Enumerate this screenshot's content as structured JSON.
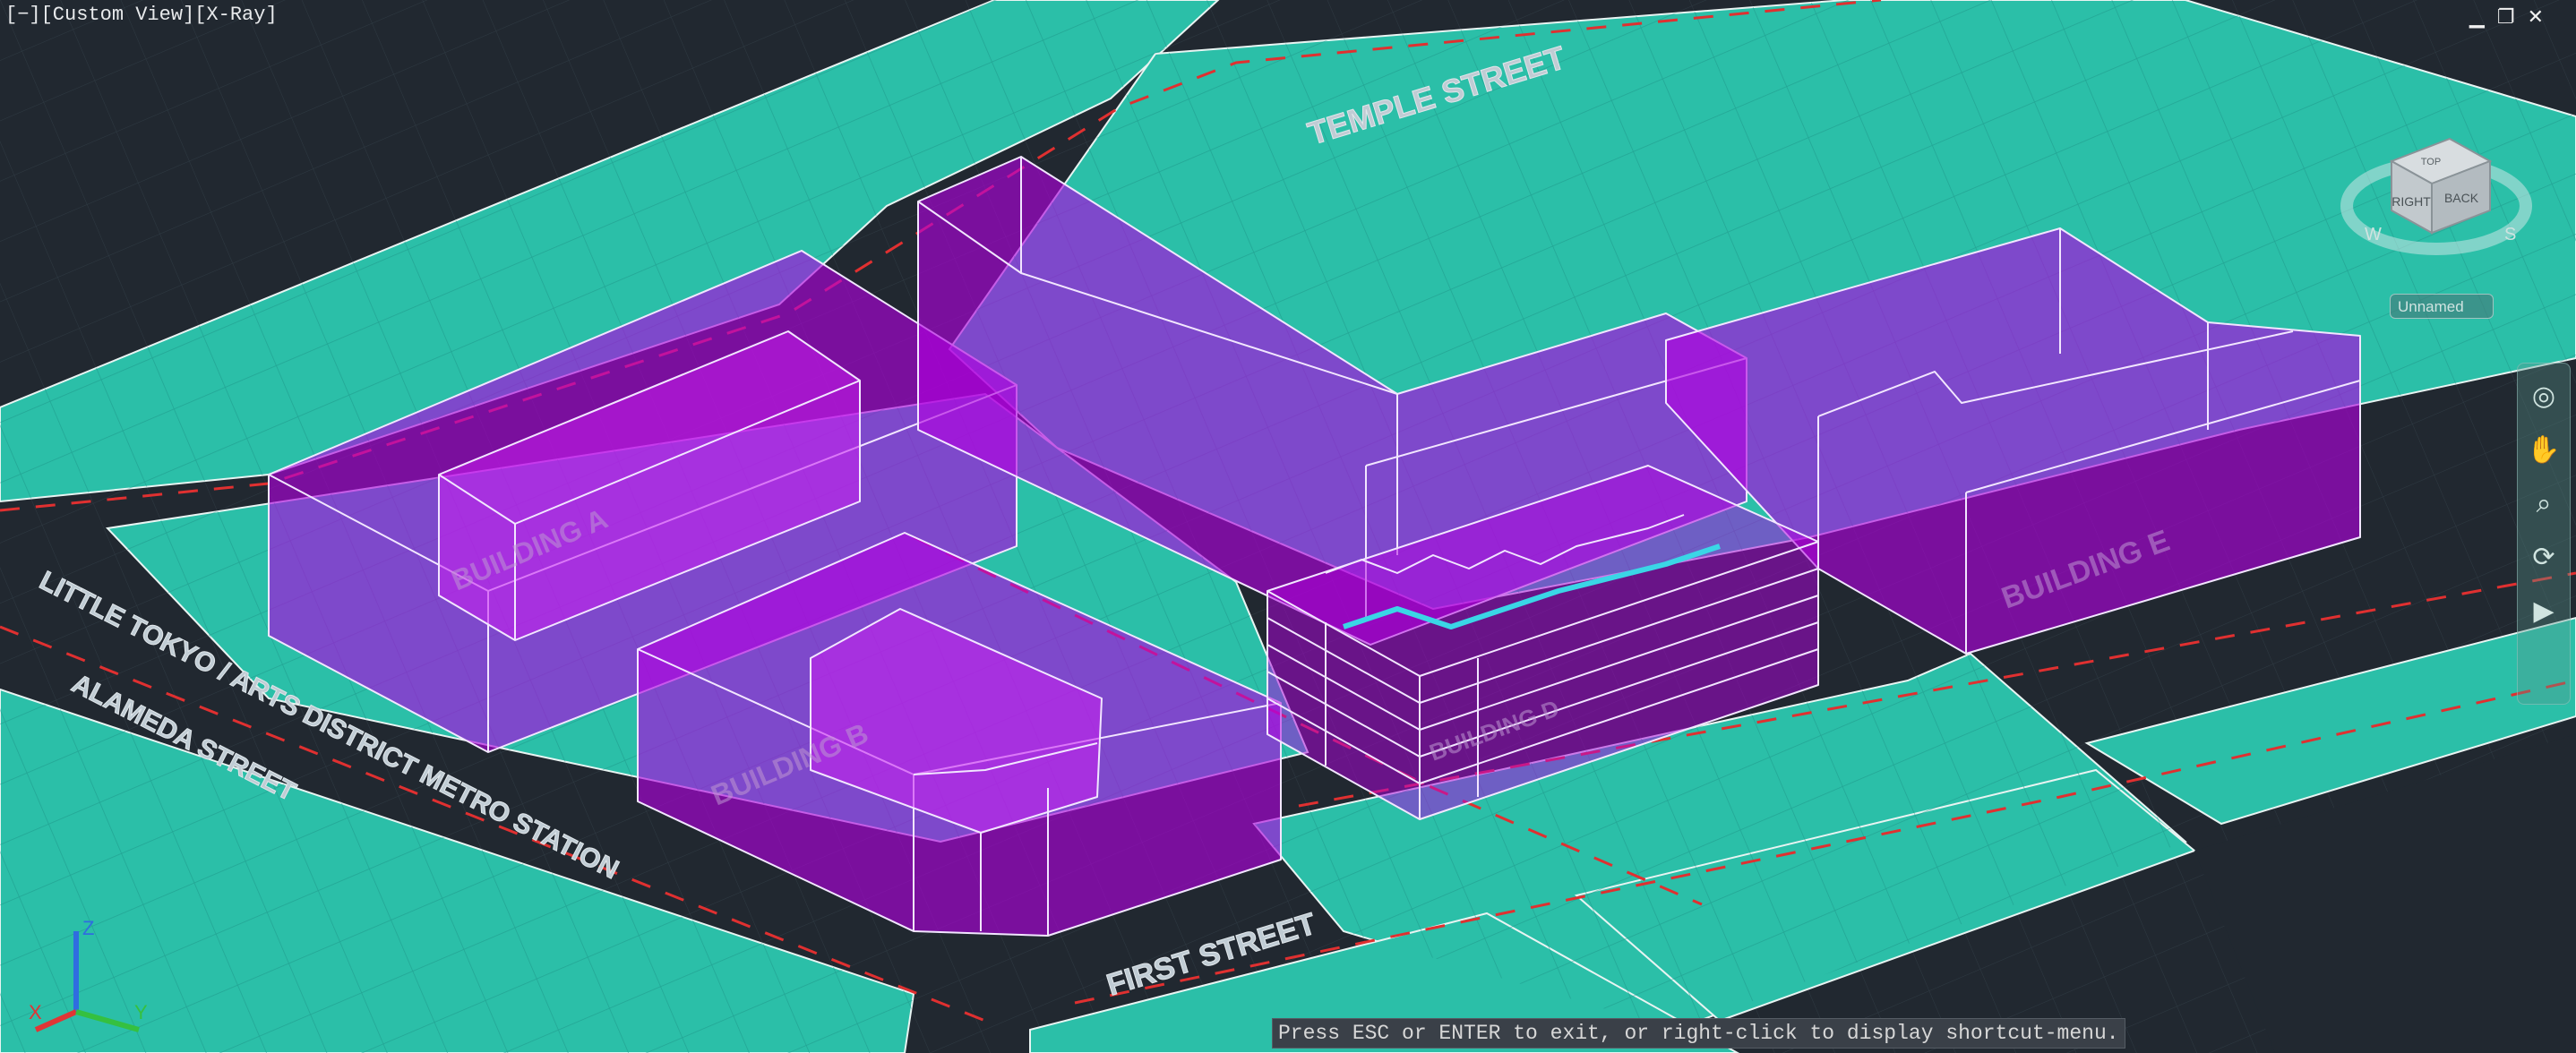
{
  "viewport_label": "[−][Custom View][X-Ray]",
  "window_controls": {
    "minimize": "▁",
    "restore": "❐",
    "close": "✕"
  },
  "streets": {
    "temple": "TEMPLE STREET",
    "first": "FIRST STREET",
    "alameda": "ALAMEDA STREET",
    "metro": "LITTLE TOKYO / ARTS DISTRICT METRO STATION"
  },
  "buildings": {
    "a": "BUILDING A",
    "b": "BUILDING B",
    "e": "BUILDING E",
    "d": "BUILDING D"
  },
  "viewcube": {
    "top": "TOP",
    "right": "RIGHT",
    "back": "BACK",
    "west": "W",
    "south": "S"
  },
  "view_name": "Unnamed",
  "command_prompt": "Press ESC or ENTER to exit, or right-click to display shortcut-menu.",
  "ucs": {
    "x": "X",
    "y": "Y",
    "z": "Z"
  },
  "colors": {
    "background": "#212830",
    "ground": "#2bbfa8",
    "building": "#b020e0",
    "road_dash": "#e03030"
  }
}
